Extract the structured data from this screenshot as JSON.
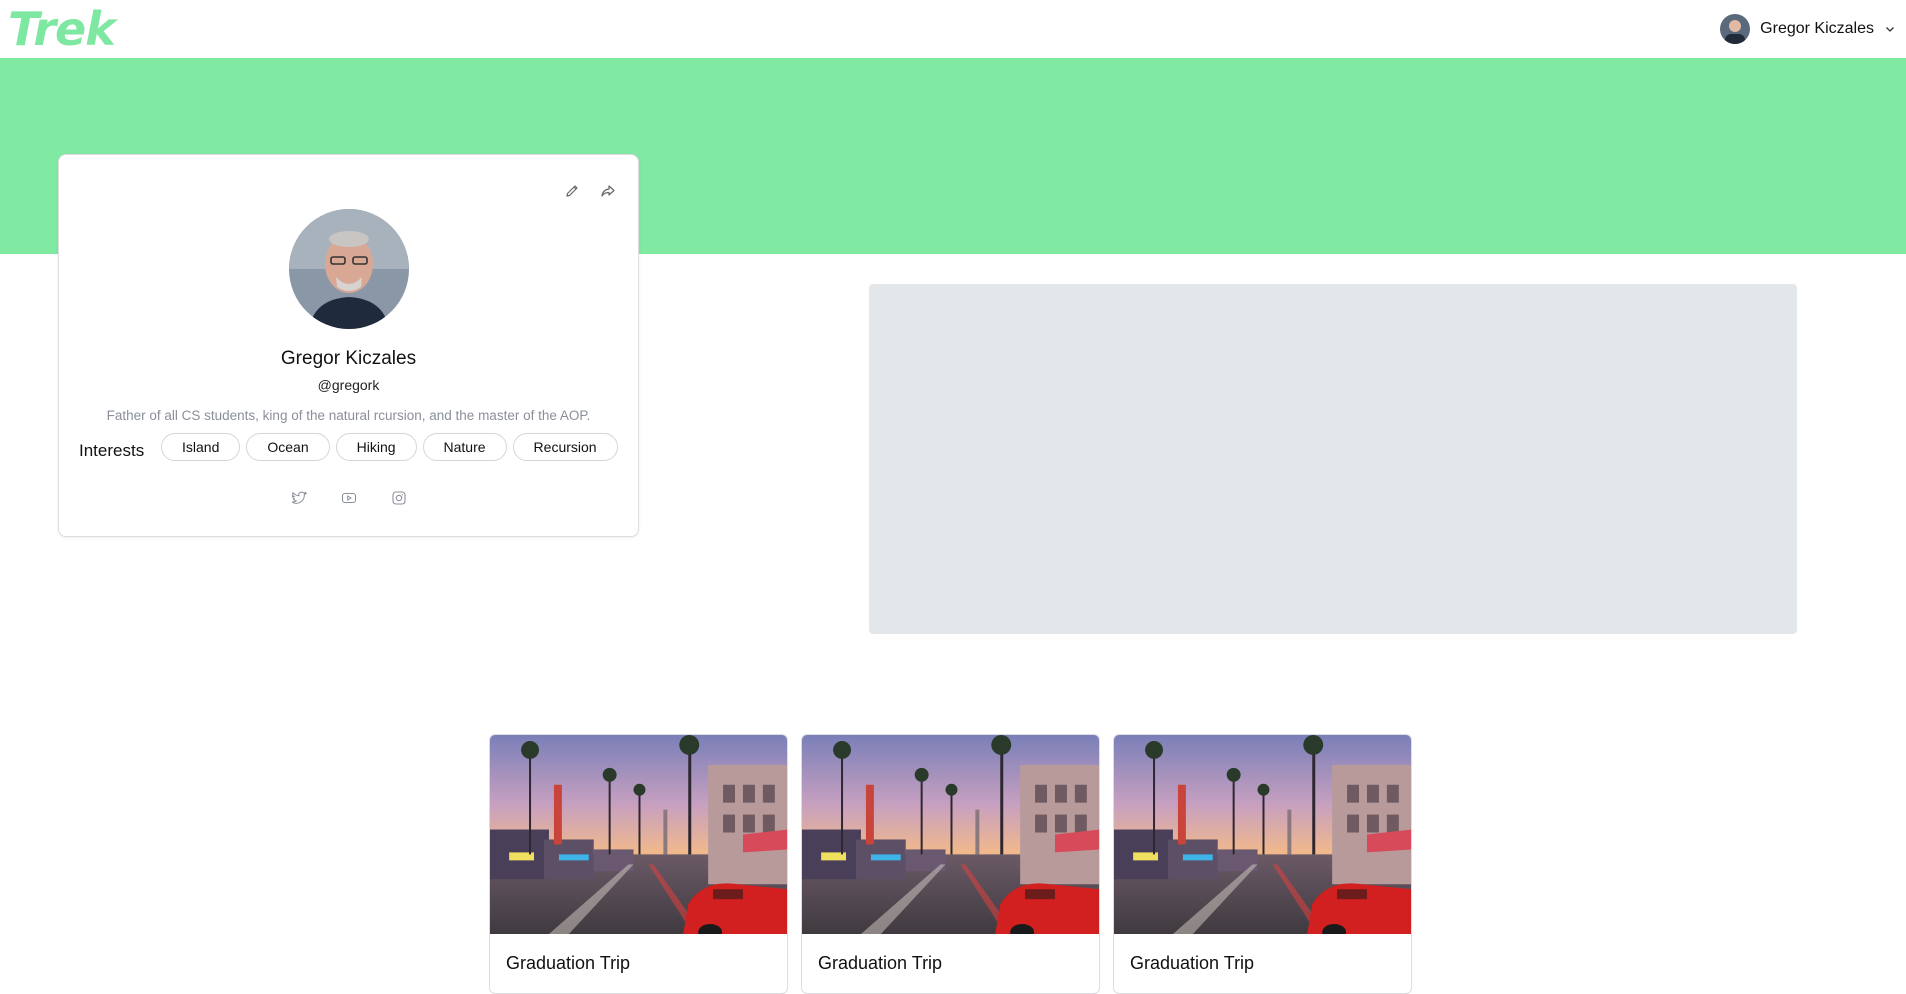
{
  "header": {
    "logo": "Trek",
    "user_name": "Gregor Kiczales"
  },
  "profile": {
    "name": "Gregor Kiczales",
    "handle": "@gregork",
    "bio": "Father of all CS students, king of the natural rcursion, and the master of the AOP.",
    "interests_label": "Interests",
    "interests": [
      "Island",
      "Ocean",
      "Hiking",
      "Nature",
      "Recursion"
    ],
    "social_icons": [
      "twitter-icon",
      "youtube-icon",
      "instagram-icon"
    ]
  },
  "trips": [
    {
      "title": "Graduation Trip"
    },
    {
      "title": "Graduation Trip"
    },
    {
      "title": "Graduation Trip"
    }
  ],
  "colors": {
    "brand": "#7ee7a2",
    "banner": "#80e9a2",
    "placeholder": "#e4e7ea"
  }
}
